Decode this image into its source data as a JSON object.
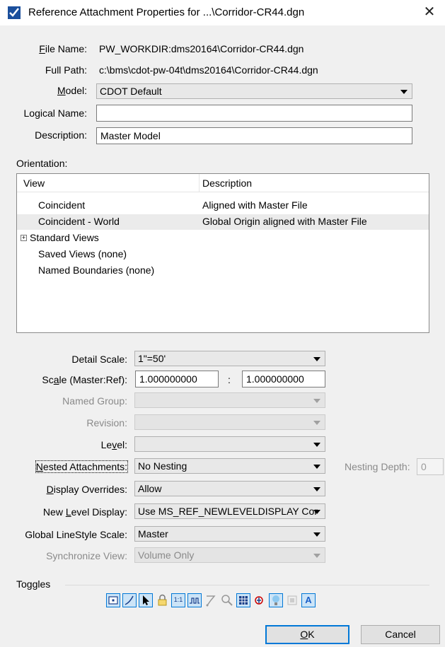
{
  "window": {
    "title": "Reference Attachment Properties for ...\\Corridor-CR44.dgn",
    "close_glyph": "✕"
  },
  "fields": {
    "file_name_label": "File Name:",
    "file_name_value": "PW_WORKDIR:dms20164\\Corridor-CR44.dgn",
    "full_path_label": "Full Path:",
    "full_path_value": "c:\\bms\\cdot-pw-04t\\dms20164\\Corridor-CR44.dgn",
    "model_label": "Model:",
    "model_value": "CDOT Default",
    "logical_name_label": "Logical Name:",
    "logical_name_value": "",
    "description_label": "Description:",
    "description_value": "Master Model"
  },
  "orientation": {
    "label": "Orientation:",
    "columns": [
      "View",
      "Description"
    ],
    "rows": [
      {
        "view": "Coincident",
        "description": "Aligned with Master File"
      },
      {
        "view": "Coincident - World",
        "description": "Global Origin aligned with Master File"
      },
      {
        "view": "Standard Views",
        "description": ""
      },
      {
        "view": "Saved Views (none)",
        "description": ""
      },
      {
        "view": "Named Boundaries (none)",
        "description": ""
      }
    ],
    "expander_glyph": "+"
  },
  "settings": {
    "detail_scale_label": "Detail Scale:",
    "detail_scale_value": "1\"=50'",
    "scale_label": "Scale (Master:Ref):",
    "scale_master": "1.000000000",
    "scale_colon": ":",
    "scale_ref": "1.000000000",
    "named_group_label": "Named Group:",
    "named_group_value": "",
    "revision_label": "Revision:",
    "revision_value": "",
    "level_label": "Level:",
    "level_value": "",
    "nested_label": "Nested Attachments:",
    "nested_value": "No Nesting",
    "nesting_depth_label": "Nesting Depth:",
    "nesting_depth_value": "0",
    "display_overrides_label": "Display Overrides:",
    "display_overrides_value": "Allow",
    "new_level_display_label": "New Level Display:",
    "new_level_display_value": "Use MS_REF_NEWLEVELDISPLAY Cor",
    "global_linestyle_label": "Global LineStyle Scale:",
    "global_linestyle_value": "Master",
    "synchronize_view_label": "Synchronize View:",
    "synchronize_view_value": "Volume Only"
  },
  "toggles": {
    "label": "Toggles",
    "icons": [
      "display-toggle-icon",
      "snap-toggle-icon",
      "locate-toggle-icon",
      "lock-toggle-icon",
      "true-scale-toggle-icon",
      "scale-line-styles-toggle-icon",
      "treat-as-element-toggle-icon",
      "ignore-warnings-toggle-icon",
      "display-raster-toggle-icon",
      "use-lights-toggle-icon",
      "light-bulb-toggle-icon",
      "disabled-toggle-icon",
      "annotation-scale-toggle-icon"
    ],
    "scale_glyph": "1:1",
    "annotation_glyph": "A"
  },
  "buttons": {
    "ok": "OK",
    "cancel": "Cancel"
  },
  "colors": {
    "accent": "#0078d7",
    "toggle_active": "#cce4f7"
  }
}
